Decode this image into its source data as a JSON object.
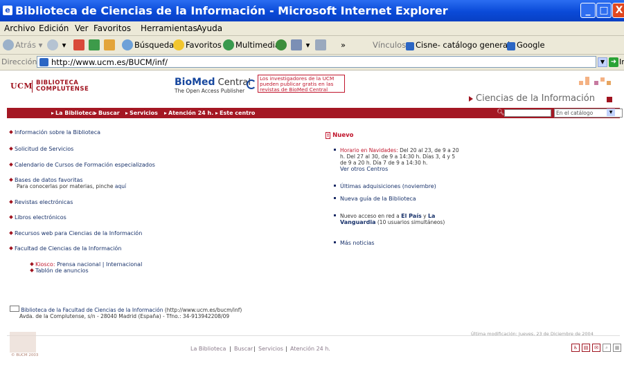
{
  "window": {
    "title": "Biblioteca de Ciencias de la Información - Microsoft Internet Explorer",
    "minimize": "_",
    "maximize": "□",
    "close": "X"
  },
  "menu": [
    "Archivo",
    "Edición",
    "Ver",
    "Favoritos",
    "Herramientas",
    "Ayuda"
  ],
  "toolbar": {
    "back": "Atrás",
    "search": "Búsqueda",
    "favorites": "Favoritos",
    "media": "Multimedia",
    "links_label": "Vínculos",
    "link1": "Cisne- catálogo general",
    "link2": "Google"
  },
  "address": {
    "label": "Dirección",
    "url": "http://www.ucm.es/BUCM/inf/",
    "go": "Ir"
  },
  "header": {
    "ucm": "UCM",
    "lib1": "BIBLIOTECA",
    "lib2": "COMPLUTENSE",
    "biomed_name": "BioMed",
    "biomed_central": " Central",
    "biomed_sub": "The Open Access Publisher",
    "biomed_ad": "Los investigadores de la UCM pueden publicar gratis en las revistas de BioMed Central",
    "section_title": "Ciencias de la Información"
  },
  "nav": {
    "items": [
      "La Biblioteca",
      "Buscar",
      "Servicios",
      "Atención 24 h.",
      "Este centro"
    ],
    "catalog_placeholder": "En el catálogo"
  },
  "left_links": {
    "l1": "Información sobre la Biblioteca",
    "l2": "Solicitud de Servicios",
    "l3": "Calendario de Cursos de Formación especializados",
    "l4": "Bases de datos favoritas",
    "l4_sub": "Para conocerlas por materias, pinche",
    "l4_sub_link": "aquí",
    "l5": "Revistas electrónicas",
    "l6": "Libros electrónicos",
    "l7": "Recursos web para Ciencias de la Información",
    "l8": "Facultad de Ciencias de la Información",
    "kiosco_label": "Kiosco:",
    "kiosco_nac": "Prensa nacional",
    "kiosco_sep": "|",
    "kiosco_int": "Internacional",
    "tablon": "Tablón de anuncios"
  },
  "news": {
    "label": "Nuevo",
    "n1_title": "Horario en Navidades:",
    "n1_line1": "Del 20 al 23, de 9 a 20",
    "n1_line2": "h. Del 27 al 30, de 9 a 14:30 h. Días 3, 4 y 5",
    "n1_line3": "de 9 a 20 h. Día 7 de 9 a 14:30 h.",
    "n1_link": "Ver otros Centros",
    "n2": "Últimas adquisiciones (noviembre)",
    "n3": "Nueva guía de la Biblioteca",
    "n4_pre": "Nuevo acceso en red a",
    "n4_elpais": "El País",
    "n4_y": "y",
    "n4_la": "La",
    "n4_vanguardia": "Vanguardia",
    "n4_post": "(10 usuarios simultáneos)",
    "n5": "Más noticias"
  },
  "address_block": {
    "line1_link": "Biblioteca de la Facultad de Ciencias de la Información",
    "line1_url": "(http://www.ucm.es/bucm/inf)",
    "line2": "Avda. de la Complutense, s/n - 28040 Madrid (España) - Tfno.: 34-913942208/09"
  },
  "footer": {
    "modified": "Última modificación: Jueves, 23 de Diciembre de 2004",
    "links": [
      "La Biblioteca",
      "Buscar",
      "Servicios",
      "Atención 24 h."
    ],
    "copyright": "© BUCM 2003"
  },
  "colors": {
    "brand_red": "#a41723",
    "link_blue": "#17316a",
    "title_blue": "#0a4ad8"
  }
}
